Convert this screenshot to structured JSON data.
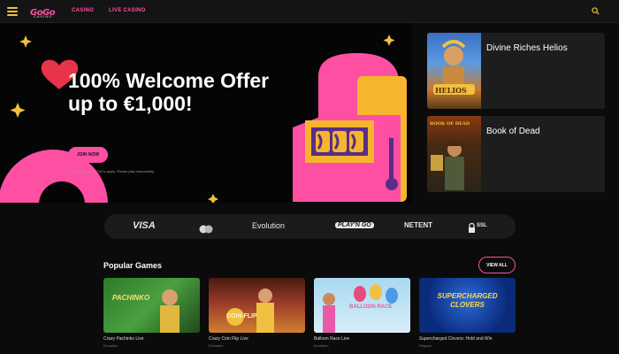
{
  "header": {
    "logo_text": "GoGo",
    "logo_sub": "CASINO",
    "nav": [
      "CASINO",
      "LIVE CASINO"
    ]
  },
  "hero": {
    "title_line1": "100% Welcome Offer",
    "title_line2": "up to €1,000!",
    "cta_label": "JOIN NOW",
    "terms": "18+ Full welcome T&Cs apply. Please play responsibly."
  },
  "side_games": [
    {
      "title": "Divine Riches Helios",
      "thumb_text": "HELIOS"
    },
    {
      "title": "Book of Dead",
      "thumb_text": "BOOK OF DEAD"
    }
  ],
  "payments": [
    "VISA",
    "mastercard",
    "Evolution",
    "PLAY'N GO",
    "NETENT",
    "SSL"
  ],
  "popular": {
    "title": "Popular Games",
    "view_all": "VIEW ALL",
    "games": [
      {
        "name": "Crazy Pachinko Live",
        "provider": "Evolution",
        "thumb_text": "PACHINKO"
      },
      {
        "name": "Crazy Coin Flip Live",
        "provider": "Evolution",
        "thumb_text": "COIN FLIP"
      },
      {
        "name": "Balloon Race Live",
        "provider": "Evolution",
        "thumb_text": "BALLOON RACE"
      },
      {
        "name": "Supercharged Clovers: Hold and Win",
        "provider": "Playson",
        "thumb_text": "SUPERCHARGED CLOVERS"
      }
    ]
  },
  "colors": {
    "accent": "#ff4fa3",
    "gold": "#f0c040",
    "bg": "#0b0b0b"
  }
}
